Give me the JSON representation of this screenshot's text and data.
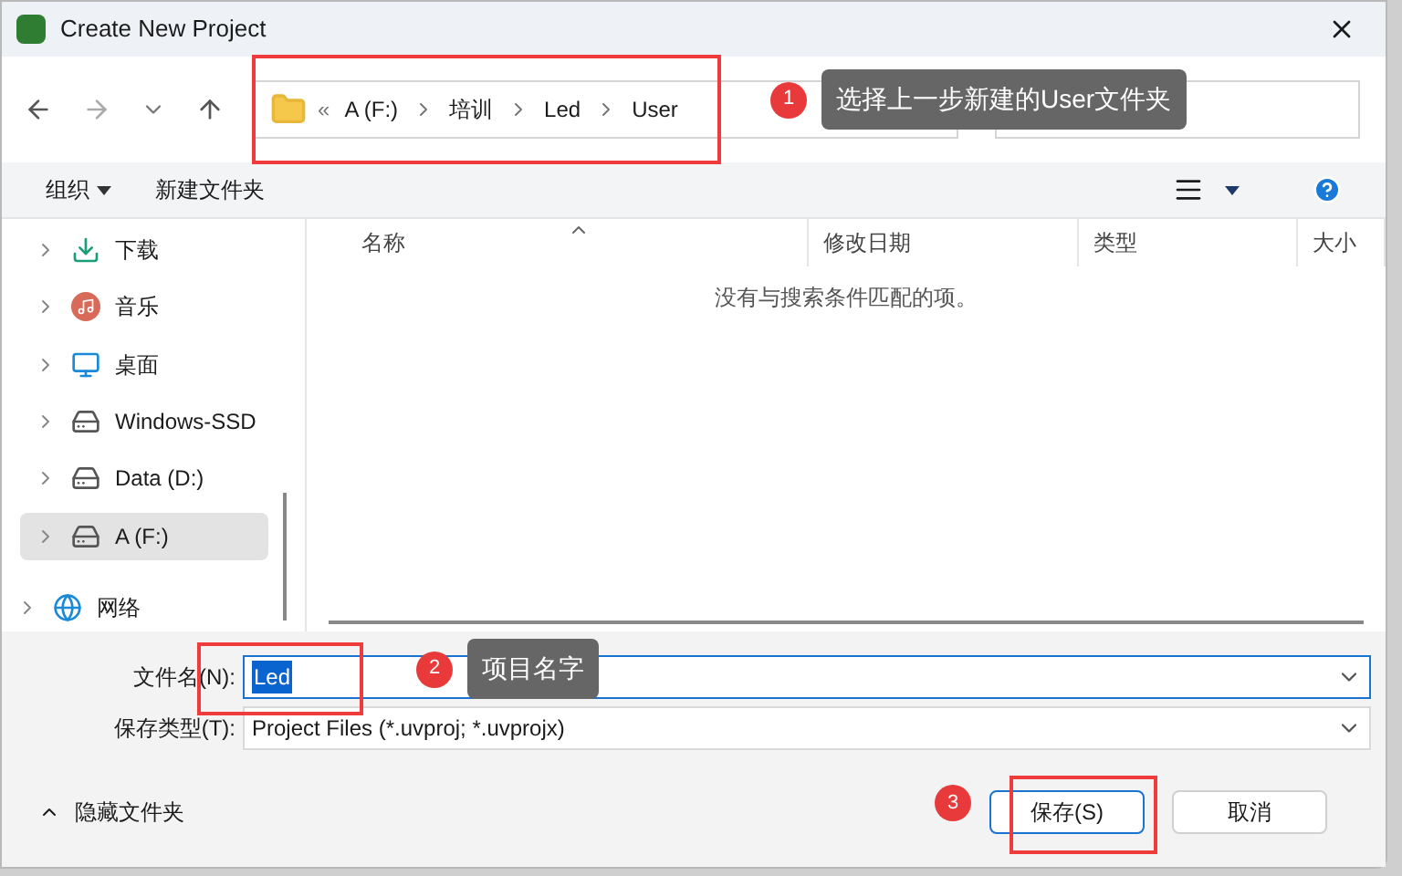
{
  "window": {
    "title": "Create New Project"
  },
  "address_bar": {
    "overflow": "«",
    "crumbs": [
      "A (F:)",
      "培训",
      "Led",
      "User"
    ]
  },
  "toolbar": {
    "organize": "组织",
    "new_folder": "新建文件夹"
  },
  "sidebar": {
    "items": [
      {
        "label": "下载",
        "kind": "download",
        "selected": false
      },
      {
        "label": "音乐",
        "kind": "music",
        "selected": false
      },
      {
        "label": "桌面",
        "kind": "desktop",
        "selected": false
      },
      {
        "label": "Windows-SSD",
        "kind": "system-drive",
        "selected": false
      },
      {
        "label": "Data (D:)",
        "kind": "drive",
        "selected": false
      },
      {
        "label": "A (F:)",
        "kind": "drive",
        "selected": true
      },
      {
        "label": "网络",
        "kind": "network",
        "selected": false
      }
    ]
  },
  "file_list": {
    "columns": [
      "名称",
      "修改日期",
      "类型",
      "大小"
    ],
    "empty_message": "没有与搜索条件匹配的项。"
  },
  "form": {
    "file_name_label": "文件名(N):",
    "file_name": "Led",
    "file_type_label": "保存类型(T):",
    "file_type": "Project Files (*.uvproj; *.uvprojx)"
  },
  "footer": {
    "hide_folders": "隐藏文件夹",
    "buttons": [
      "保存(S)",
      "取消"
    ]
  },
  "annotations": [
    {
      "number": "1",
      "text": "选择上一步新建的User文件夹"
    },
    {
      "number": "2",
      "text": "项目名字"
    },
    {
      "number": "3"
    }
  ]
}
